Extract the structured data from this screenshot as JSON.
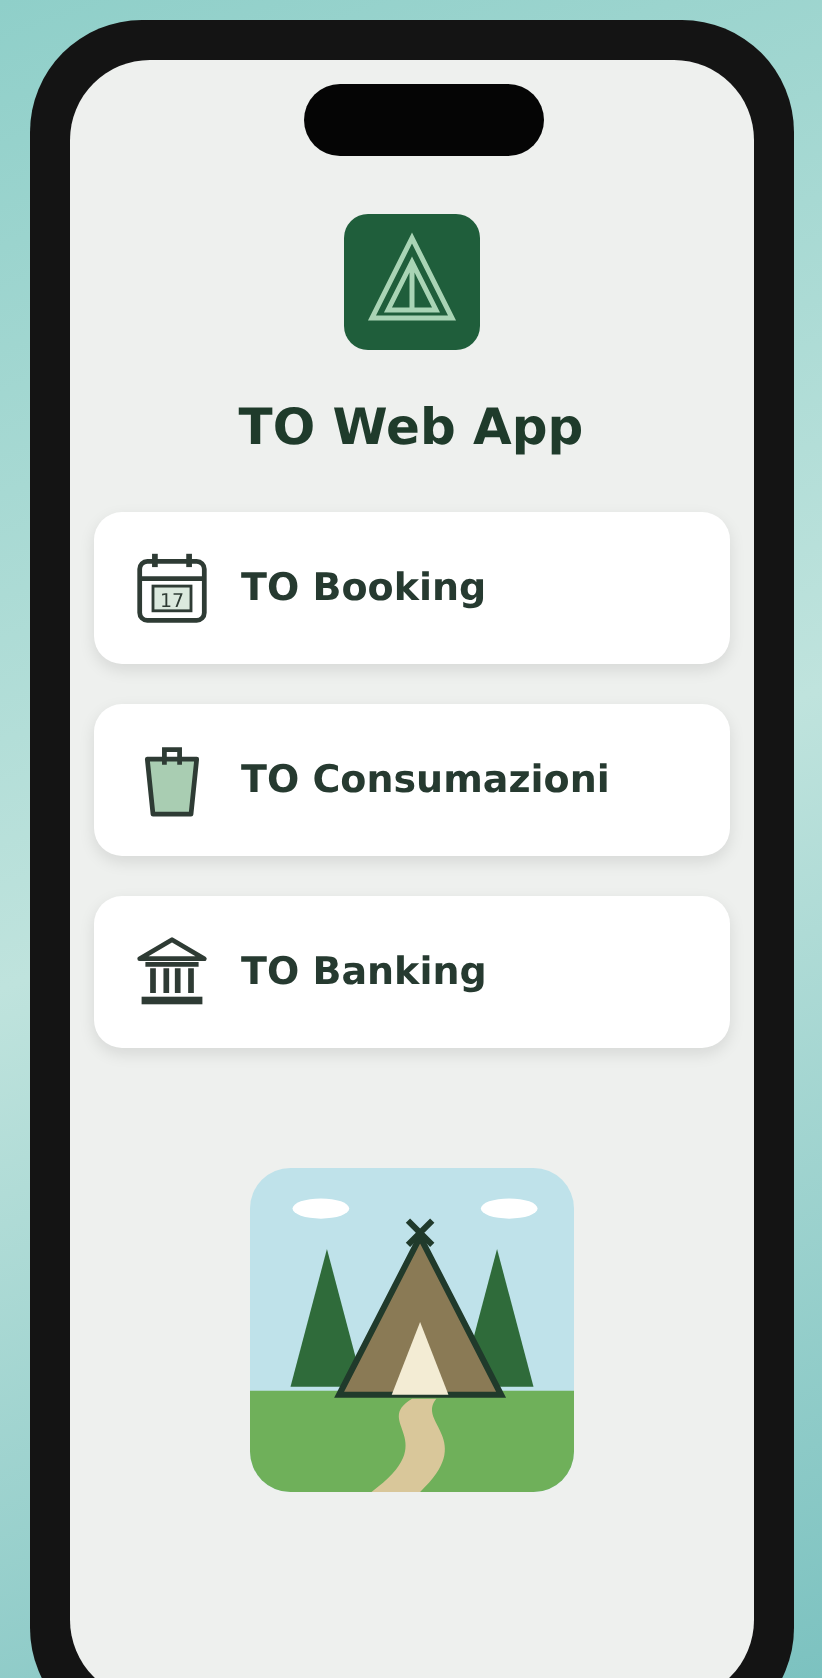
{
  "app": {
    "title": "TO Web App"
  },
  "menu": [
    {
      "kind": "calendar",
      "label": "TO Booking",
      "date": "17"
    },
    {
      "kind": "bag",
      "label": "TO Consumazioni"
    },
    {
      "kind": "bank",
      "label": "TO Banking"
    }
  ]
}
